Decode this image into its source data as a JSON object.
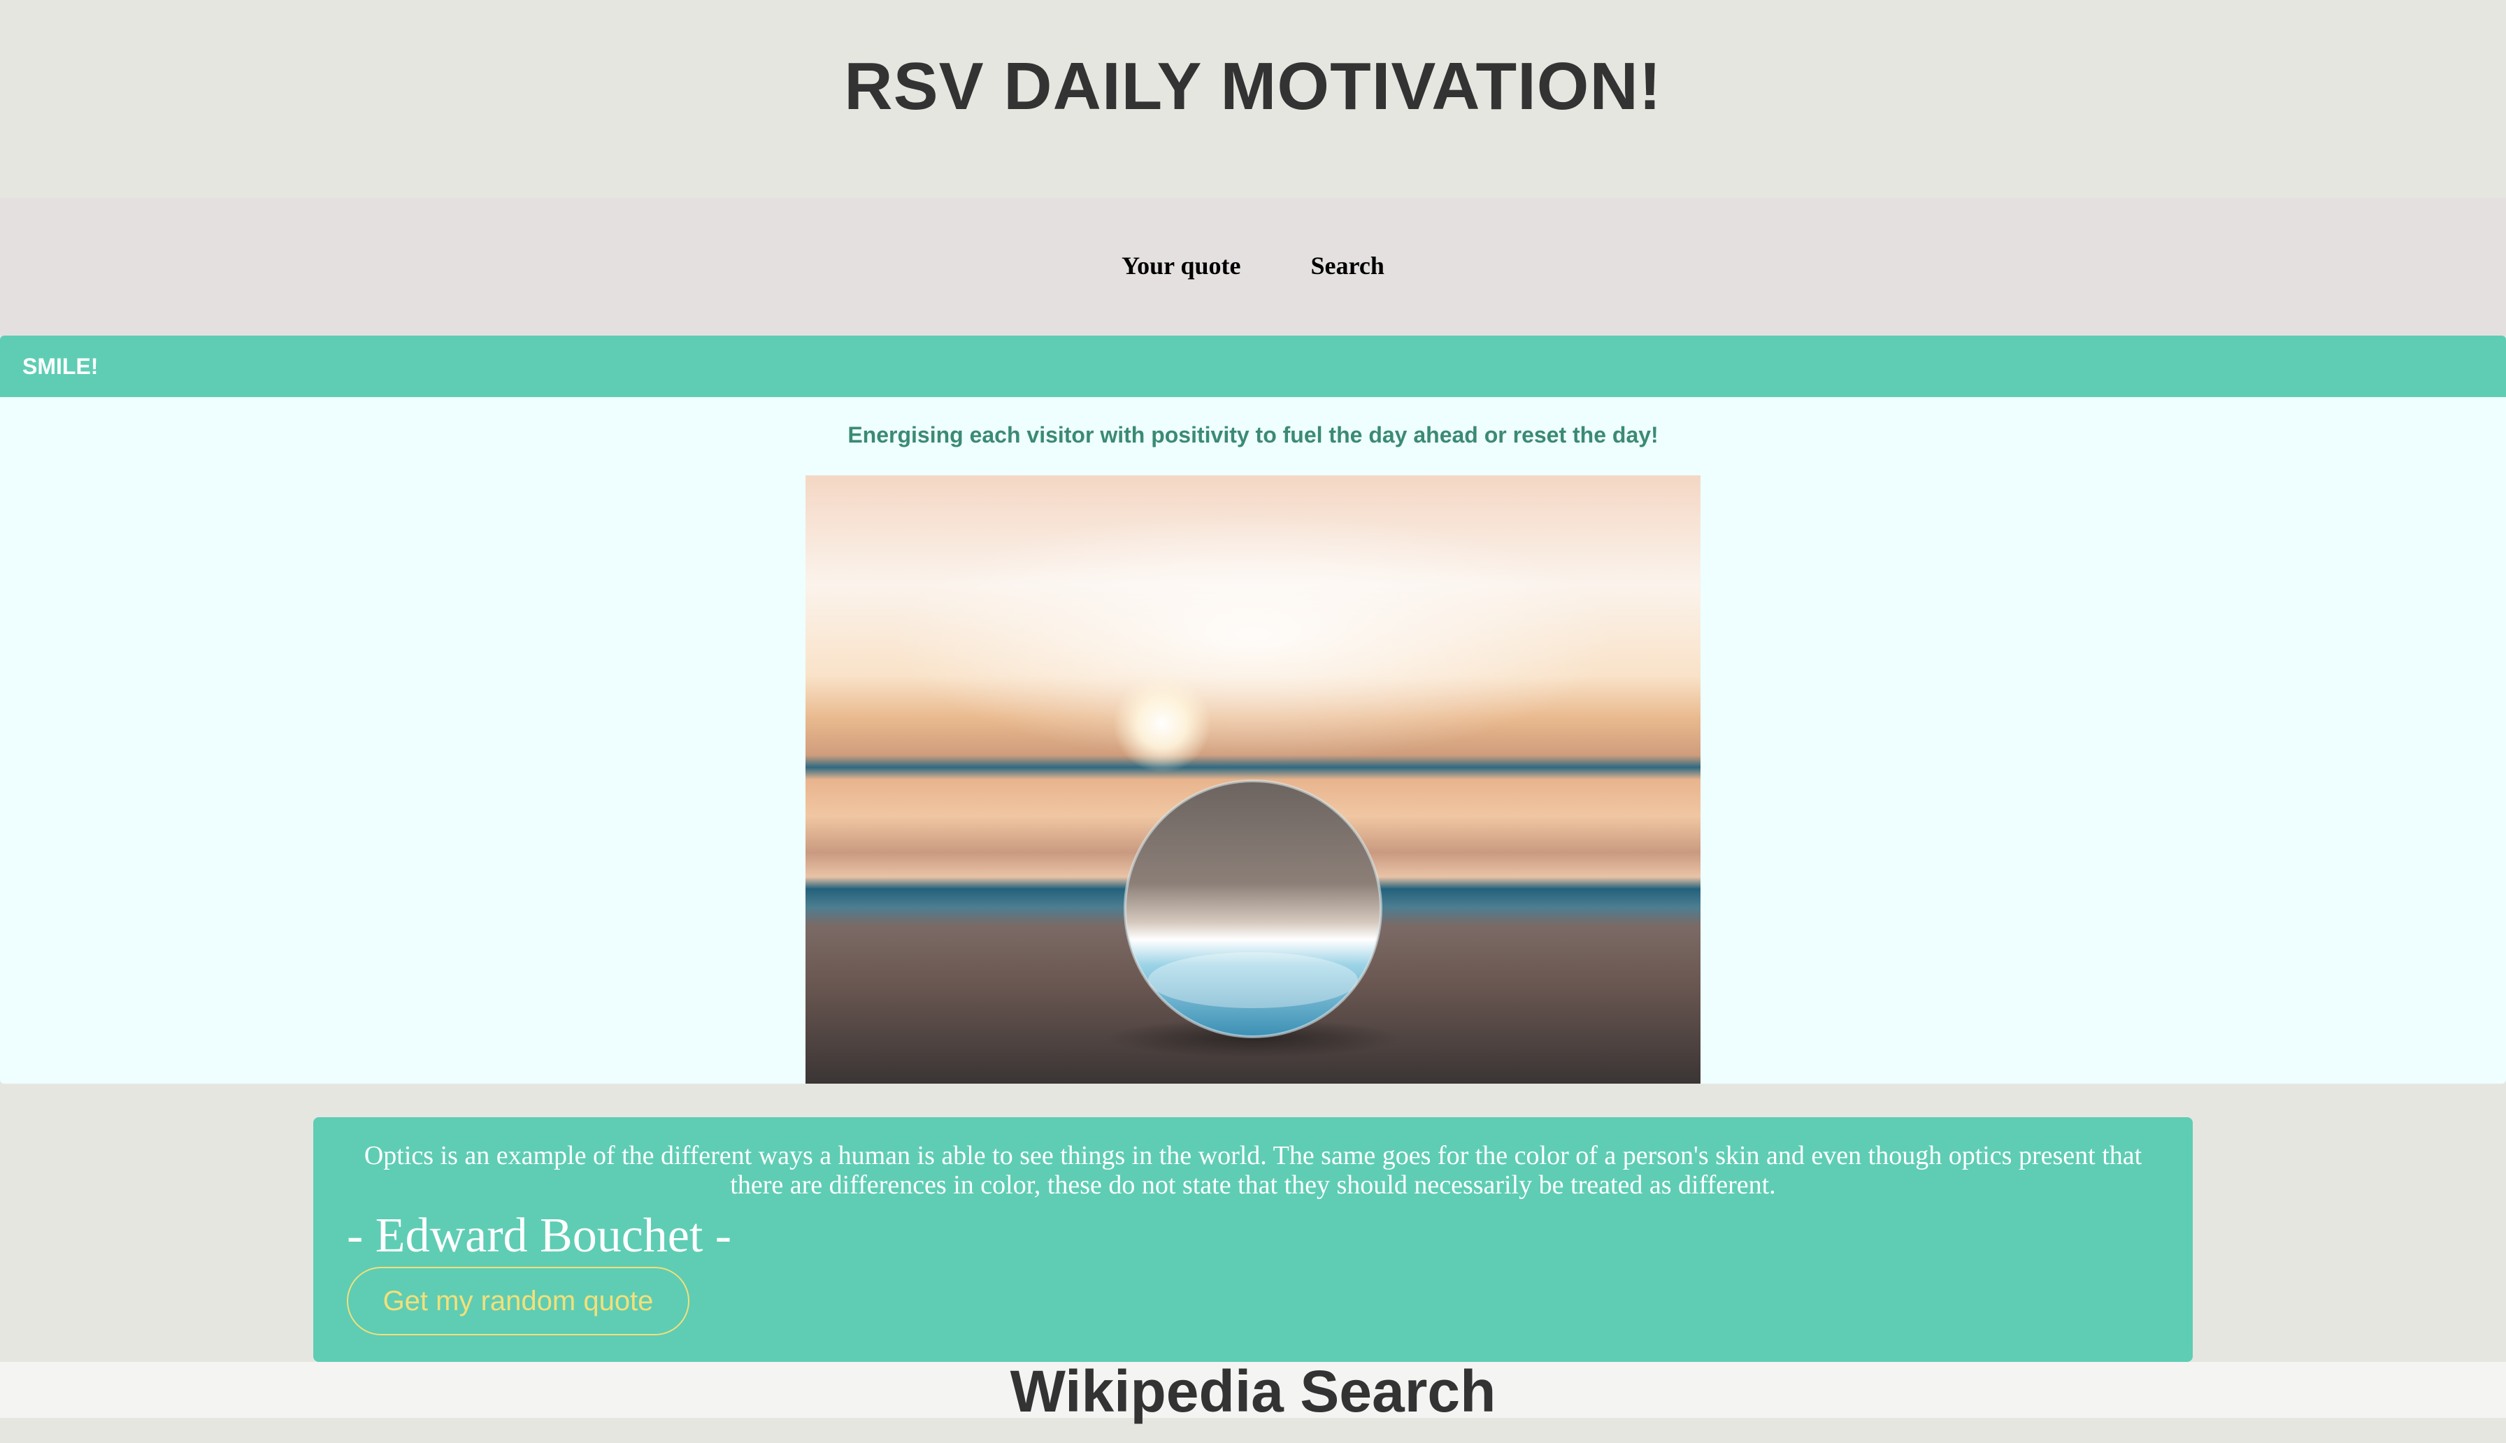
{
  "header": {
    "title": "RSV DAILY MOTIVATION!"
  },
  "nav": {
    "items": [
      {
        "label": "Your quote"
      },
      {
        "label": "Search"
      }
    ]
  },
  "card": {
    "header": "SMILE!",
    "tagline": "Energising each visitor with positivity to fuel the day ahead or reset the day!"
  },
  "quote": {
    "text": "Optics is an example of the different ways a human is able to see things in the world. The same goes for the color of a person's skin and even though optics present that there are differences in color, these do not state that they should necessarily be treated as different.",
    "author": "- Edward Bouchet -",
    "button_label": "Get my random quote"
  },
  "wiki": {
    "title": "Wikipedia Search"
  },
  "colors": {
    "page_bg": "#e6e6e1",
    "nav_bg": "#e5e0e0",
    "accent_teal": "#5ecdb4",
    "card_bg": "#efffff",
    "tagline": "#3b8a74",
    "button_text": "#f3e07a"
  }
}
